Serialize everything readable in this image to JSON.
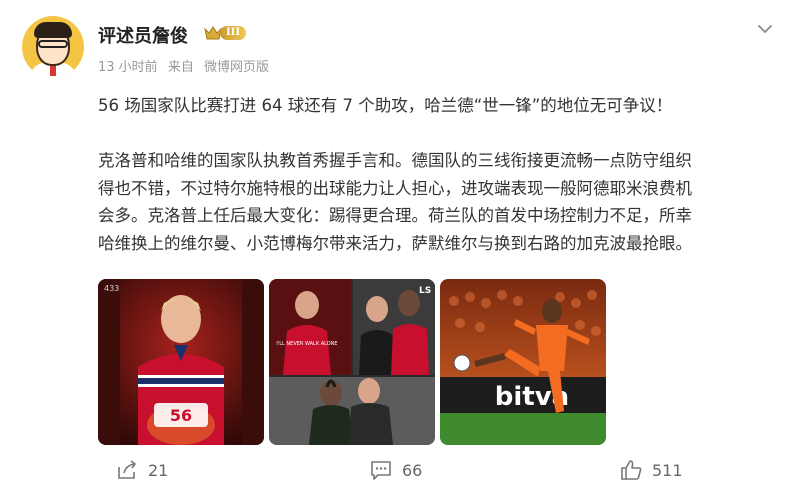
{
  "author": {
    "name": "评述员詹俊",
    "rank_level": "III"
  },
  "meta": {
    "time": "13 小时前",
    "source_prefix": "来自",
    "source": "微博网页版"
  },
  "content": {
    "line1": "56 场国家队比赛打进 64 球还有 7 个助攻，哈兰德“世一锋”的地位无可争议！",
    "para2_l1": "克洛普和哈维的国家队执教首秀握手言和。德国队的三线衔接更流畅一点防守组织",
    "para2_l2": "得也不错，不过特尔施特根的出球能力让人担心，进攻端表现一般阿德耶米浪费机",
    "para2_l3": "会多。克洛普上任后最大变化：踢得更合理。荷兰队的首发中场控制力不足，所幸",
    "para2_l4": "哈维换上的维尔曼、小范博梅尔带来活力，萨默维尔与换到右路的加克波最抢眼。"
  },
  "media": {
    "photo1": {
      "jersey_number": "56",
      "corner_mark": "433"
    },
    "photo2": {
      "corner_mark": "LS",
      "shirt_text": "I'LL NEVER WALK ALONE"
    },
    "photo3": {
      "board_text": "bitva"
    }
  },
  "actions": {
    "share_count": "21",
    "comment_count": "66",
    "like_count": "511"
  },
  "colors": {
    "norway_red": "#c8102e",
    "netherlands_orange": "#f36c21",
    "liverpool_red": "#c8102e"
  }
}
